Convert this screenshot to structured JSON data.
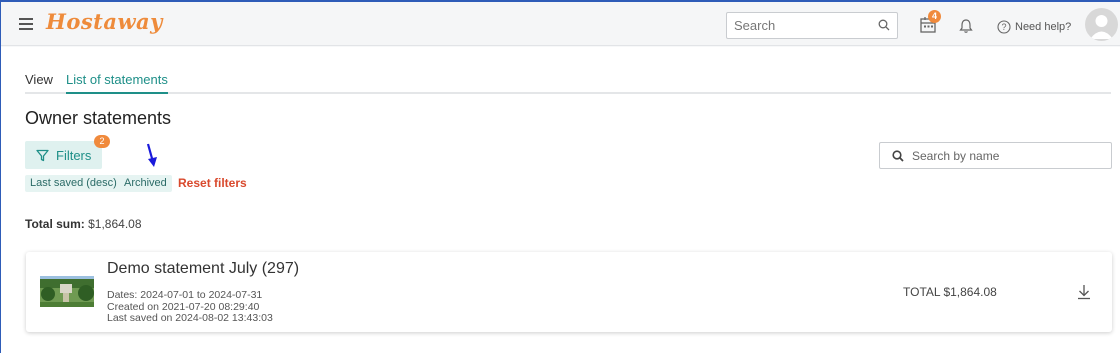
{
  "header": {
    "logo": "Hostaway",
    "search_placeholder": "Search",
    "notifications_count": "4",
    "help_label": "Need help?"
  },
  "tabs": [
    {
      "label": "View"
    },
    {
      "label": "List of statements"
    }
  ],
  "page_title": "Owner statements",
  "filters": {
    "button_label": "Filters",
    "count": "2",
    "chips": [
      "Last saved (desc)",
      "Archived"
    ],
    "reset_label": "Reset filters"
  },
  "name_search": {
    "placeholder": "Search by name"
  },
  "total_sum": {
    "label": "Total sum:",
    "value": "$1,864.08"
  },
  "statements": [
    {
      "title": "Demo statement July (297)",
      "dates": "Dates: 2024-07-01 to 2024-07-31",
      "created": "Created on 2021-07-20 08:29:40",
      "last_saved": "Last saved on 2024-08-02 13:43:03",
      "total": "TOTAL $1,864.08"
    }
  ],
  "colors": {
    "accent": "#1e8f88",
    "brand": "#ee8b3b",
    "badge": "#f08a3c",
    "reset": "#d9492d"
  }
}
